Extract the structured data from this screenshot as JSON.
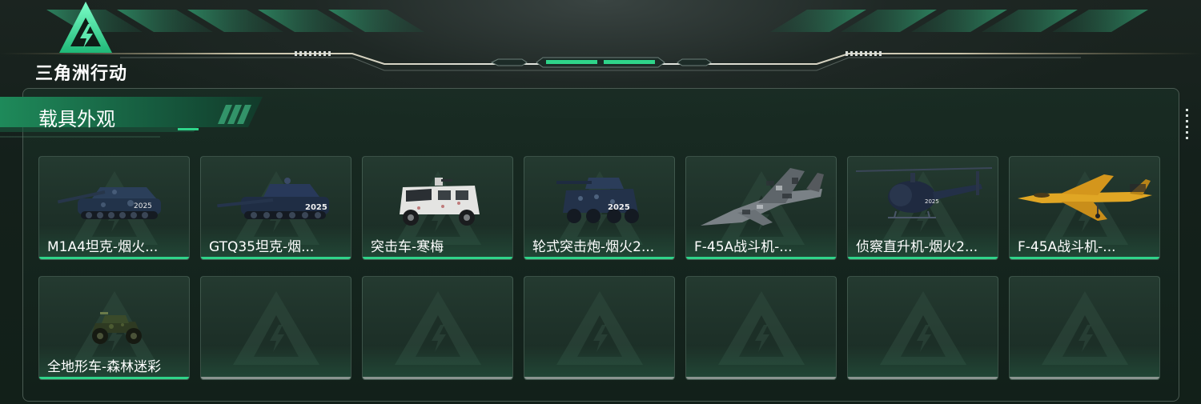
{
  "app": {
    "logo_text": "三角洲行动"
  },
  "section": {
    "title": "载具外观"
  },
  "colors": {
    "accent": "#2fd48a",
    "empty_bar": "#8a9590",
    "panel_border": "#4a5a52"
  },
  "vehicles": [
    {
      "name": "M1A4坦克-烟火...",
      "type": "tank",
      "filled": true
    },
    {
      "name": "GTQ35坦克-烟...",
      "type": "tank2",
      "filled": true
    },
    {
      "name": "突击车-寒梅",
      "type": "armored-car-white",
      "filled": true
    },
    {
      "name": "轮式突击炮-烟火2...",
      "type": "armored-car",
      "filled": true
    },
    {
      "name": "F-45A战斗机-...",
      "type": "jet-camo",
      "filled": true
    },
    {
      "name": "侦察直升机-烟火2...",
      "type": "helicopter",
      "filled": true
    },
    {
      "name": "F-45A战斗机-...",
      "type": "jet-yellow",
      "filled": true
    },
    {
      "name": "全地形车-森林迷彩",
      "type": "atv",
      "filled": true
    },
    {
      "name": "",
      "type": "empty",
      "filled": false
    },
    {
      "name": "",
      "type": "empty",
      "filled": false
    },
    {
      "name": "",
      "type": "empty",
      "filled": false
    },
    {
      "name": "",
      "type": "empty",
      "filled": false
    },
    {
      "name": "",
      "type": "empty",
      "filled": false
    },
    {
      "name": "",
      "type": "empty",
      "filled": false
    }
  ]
}
